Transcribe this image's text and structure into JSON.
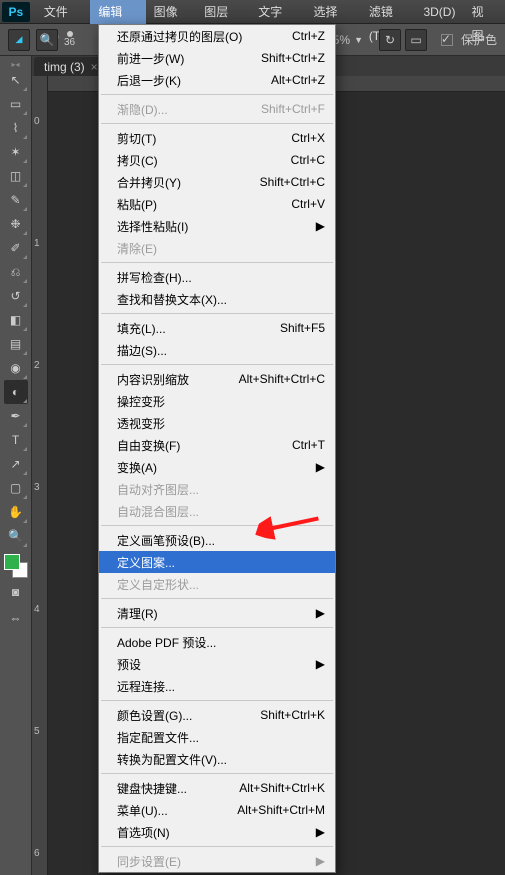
{
  "menubar": {
    "items": [
      "文件(F)",
      "编辑(E)",
      "图像(I)",
      "图层(L)",
      "文字(Y)",
      "选择(S)",
      "滤镜(T)",
      "3D(D)",
      "视图"
    ]
  },
  "ps_label": "Ps",
  "optbar": {
    "brush_size": "36",
    "zoom": "25%",
    "preserve_color": "保护色"
  },
  "doc_tab": {
    "name": "timg (3)",
    "close": "×"
  },
  "ruler_ticks": [
    "0",
    "1",
    "2",
    "3",
    "4",
    "5",
    "6"
  ],
  "dropdown": {
    "groups": [
      [
        {
          "label": "还原通过拷贝的图层(O)",
          "short": "Ctrl+Z"
        },
        {
          "label": "前进一步(W)",
          "short": "Shift+Ctrl+Z"
        },
        {
          "label": "后退一步(K)",
          "short": "Alt+Ctrl+Z"
        }
      ],
      [
        {
          "label": "渐隐(D)...",
          "short": "Shift+Ctrl+F",
          "disabled": true
        }
      ],
      [
        {
          "label": "剪切(T)",
          "short": "Ctrl+X"
        },
        {
          "label": "拷贝(C)",
          "short": "Ctrl+C"
        },
        {
          "label": "合并拷贝(Y)",
          "short": "Shift+Ctrl+C"
        },
        {
          "label": "粘贴(P)",
          "short": "Ctrl+V"
        },
        {
          "label": "选择性粘贴(I)",
          "sub": true
        },
        {
          "label": "清除(E)",
          "disabled": true
        }
      ],
      [
        {
          "label": "拼写检查(H)..."
        },
        {
          "label": "查找和替换文本(X)..."
        }
      ],
      [
        {
          "label": "填充(L)...",
          "short": "Shift+F5"
        },
        {
          "label": "描边(S)..."
        }
      ],
      [
        {
          "label": "内容识别缩放",
          "short": "Alt+Shift+Ctrl+C"
        },
        {
          "label": "操控变形"
        },
        {
          "label": "透视变形"
        },
        {
          "label": "自由变换(F)",
          "short": "Ctrl+T"
        },
        {
          "label": "变换(A)",
          "sub": true
        },
        {
          "label": "自动对齐图层...",
          "disabled": true
        },
        {
          "label": "自动混合图层...",
          "disabled": true
        }
      ],
      [
        {
          "label": "定义画笔预设(B)..."
        },
        {
          "label": "定义图案...",
          "highlight": true
        },
        {
          "label": "定义自定形状...",
          "disabled": true
        }
      ],
      [
        {
          "label": "清理(R)",
          "sub": true
        }
      ],
      [
        {
          "label": "Adobe PDF 预设..."
        },
        {
          "label": "预设",
          "sub": true
        },
        {
          "label": "远程连接..."
        }
      ],
      [
        {
          "label": "颜色设置(G)...",
          "short": "Shift+Ctrl+K"
        },
        {
          "label": "指定配置文件..."
        },
        {
          "label": "转换为配置文件(V)..."
        }
      ],
      [
        {
          "label": "键盘快捷键...",
          "short": "Alt+Shift+Ctrl+K"
        },
        {
          "label": "菜单(U)...",
          "short": "Alt+Shift+Ctrl+M"
        },
        {
          "label": "首选项(N)",
          "sub": true
        }
      ],
      [
        {
          "label": "同步设置(E)",
          "sub": true,
          "disabled": true
        }
      ]
    ]
  },
  "tools": [
    {
      "name": "move-tool",
      "glyph": "↖"
    },
    {
      "name": "marquee-tool",
      "glyph": "▭"
    },
    {
      "name": "lasso-tool",
      "glyph": "⌇"
    },
    {
      "name": "magic-wand-tool",
      "glyph": "✶"
    },
    {
      "name": "crop-tool",
      "glyph": "◫"
    },
    {
      "name": "eyedropper-tool",
      "glyph": "✎"
    },
    {
      "name": "healing-tool",
      "glyph": "❉"
    },
    {
      "name": "brush-tool",
      "glyph": "✐"
    },
    {
      "name": "stamp-tool",
      "glyph": "⎌"
    },
    {
      "name": "history-brush-tool",
      "glyph": "↺"
    },
    {
      "name": "eraser-tool",
      "glyph": "◧"
    },
    {
      "name": "gradient-tool",
      "glyph": "▤"
    },
    {
      "name": "blur-tool",
      "glyph": "◉"
    },
    {
      "name": "dodge-tool",
      "glyph": "◐"
    },
    {
      "name": "pen-tool",
      "glyph": "✒"
    },
    {
      "name": "type-tool",
      "glyph": "T"
    },
    {
      "name": "path-select-tool",
      "glyph": "↗"
    },
    {
      "name": "shape-tool",
      "glyph": "▢"
    },
    {
      "name": "hand-tool",
      "glyph": "✋"
    },
    {
      "name": "zoom-tool",
      "glyph": "🔍"
    }
  ]
}
